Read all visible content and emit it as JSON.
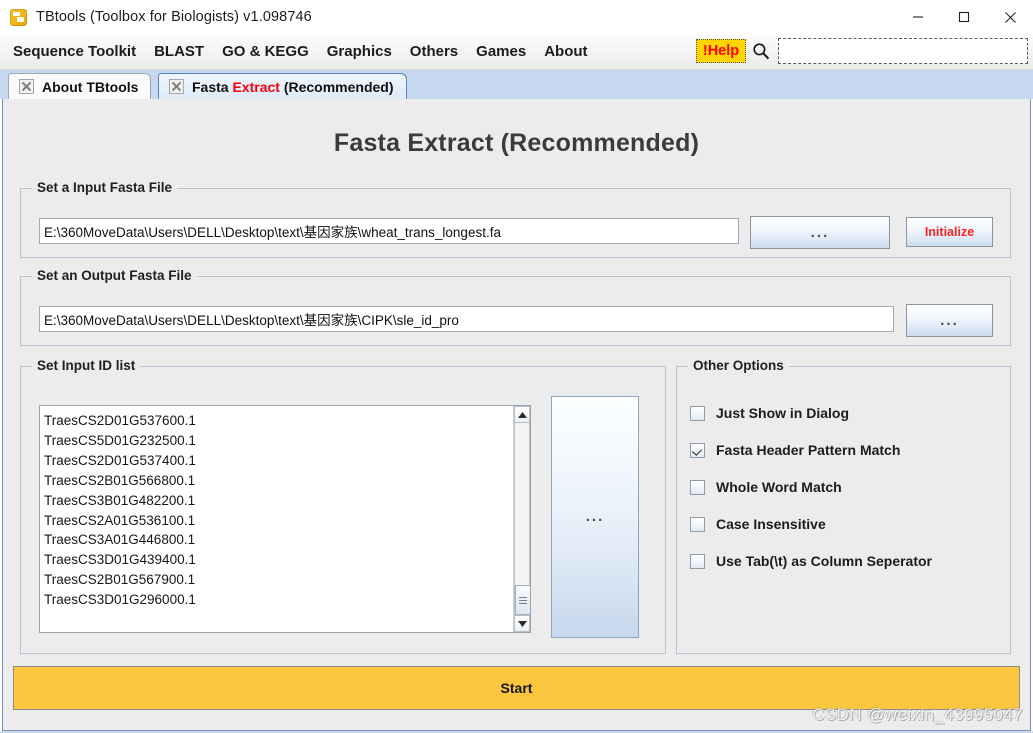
{
  "window": {
    "title": "TBtools (Toolbox for Biologists) v1.098746",
    "app_icon": "toolbox-icon",
    "minimize_label": "—",
    "maximize_label": "☐",
    "close_label": "✕"
  },
  "menubar": {
    "items": [
      {
        "label": "Sequence Toolkit"
      },
      {
        "label": "BLAST"
      },
      {
        "label": "GO & KEGG"
      },
      {
        "label": "Graphics"
      },
      {
        "label": "Others"
      },
      {
        "label": "Games"
      },
      {
        "label": "About"
      }
    ],
    "help_label": "!Help",
    "help_bg": "#ffd400",
    "help_fg": "#ff0000",
    "search_icon": "magnifier-icon",
    "search_value": "",
    "search_placeholder": ""
  },
  "tabs": [
    {
      "label": "About TBtools",
      "active": false,
      "close_icon": "close-box-icon"
    },
    {
      "label_prefix": "Fasta ",
      "label_highlight": "Extract",
      "label_suffix": " (Recommended)",
      "active": true,
      "close_icon": "close-box-icon"
    }
  ],
  "page": {
    "title": "Fasta Extract (Recommended)"
  },
  "input_group": {
    "title": "Set a Input Fasta File",
    "path_value": "E:\\360MoveData\\Users\\DELL\\Desktop\\text\\基因家族\\wheat_trans_longest.fa",
    "path_placeholder": "",
    "browse_label": "...",
    "initialize_label": "Initialize",
    "initialize_color": "#fb2222"
  },
  "output_group": {
    "title": "Set an Output Fasta File",
    "path_value": "E:\\360MoveData\\Users\\DELL\\Desktop\\text\\基因家族\\CIPK\\sle_id_pro",
    "path_placeholder": "",
    "browse_label": "..."
  },
  "idlist_group": {
    "title": "Set Input ID list",
    "browse_label": "...",
    "items": [
      "TraesCS2D01G537600.1",
      "TraesCS5D01G232500.1",
      "TraesCS2D01G537400.1",
      "TraesCS2B01G566800.1",
      "TraesCS3B01G482200.1",
      "TraesCS2A01G536100.1",
      "TraesCS3A01G446800.1",
      "TraesCS3D01G439400.1",
      "TraesCS2B01G567900.1",
      "TraesCS3D01G296000.1"
    ],
    "scrollbar": {
      "up_icon": "triangle-up-icon",
      "down_icon": "triangle-down-icon",
      "thumb_position": "bottom"
    }
  },
  "other_options": {
    "title": "Other Options",
    "items": [
      {
        "label": "Just Show in Dialog",
        "checked": false
      },
      {
        "label": "Fasta Header Pattern Match",
        "checked": true
      },
      {
        "label": "Whole Word Match",
        "checked": false
      },
      {
        "label": "Case Insensitive",
        "checked": false
      },
      {
        "label": "Use Tab(\\t) as Column Seperator",
        "checked": false
      }
    ]
  },
  "start_button": {
    "label": "Start",
    "color": "#fcc63f"
  },
  "watermark": {
    "text": "CSDN @weixin_43995047"
  }
}
